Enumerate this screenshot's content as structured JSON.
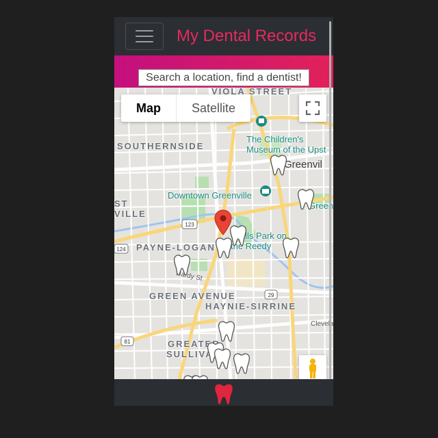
{
  "app": {
    "title": "My Dental Records"
  },
  "search": {
    "placeholder": "Search a location, find a dentist!"
  },
  "map": {
    "type_buttons": [
      "Map",
      "Satellite"
    ],
    "active_type": "Map",
    "labels": {
      "viola_street": "VIOLA STREET",
      "southernside": "SOUTHERNSIDE",
      "childrens_museum_1": "The Children's",
      "childrens_museum_2": "Museum of the Upst",
      "greenville": "Greenvil",
      "downtown_greenville": "Downtown Greenville",
      "st": "ST",
      "ville": "VILLE",
      "green_right": "Green",
      "park_1": "Falls Park on",
      "park_2": "the Reedy",
      "payne_logan": "PAYNE-LOGAN",
      "hardy_st": "Hardy St",
      "green_avenue": "GREEN AVENUE",
      "haynie_sirrine": "HAYNIE-SIRRINE",
      "cleveland": "Clevelan",
      "greater": "GREATER",
      "sullivan": "SULLIVA"
    },
    "route_shields": [
      "123",
      "124",
      "29",
      "81"
    ],
    "dentist_marker_count": 12,
    "colors": {
      "land": "#e5e3df",
      "highway": "#f9d67a",
      "park": "#b8dfb2",
      "poi": "#1a8a80",
      "pin": "#e94335"
    }
  },
  "icons": {
    "menu": "hamburger-menu-icon",
    "fullscreen": "fullscreen-icon",
    "street_view": "pegman-icon",
    "dentist_marker": "tooth-icon",
    "location_pin": "map-pin-icon",
    "footer_logo": "tooth-icon"
  },
  "theme": {
    "accent": "#e8295f",
    "navbar_bg": "#2b2e33",
    "gradient_start": "#c40f7e",
    "gradient_end": "#e2215a"
  }
}
